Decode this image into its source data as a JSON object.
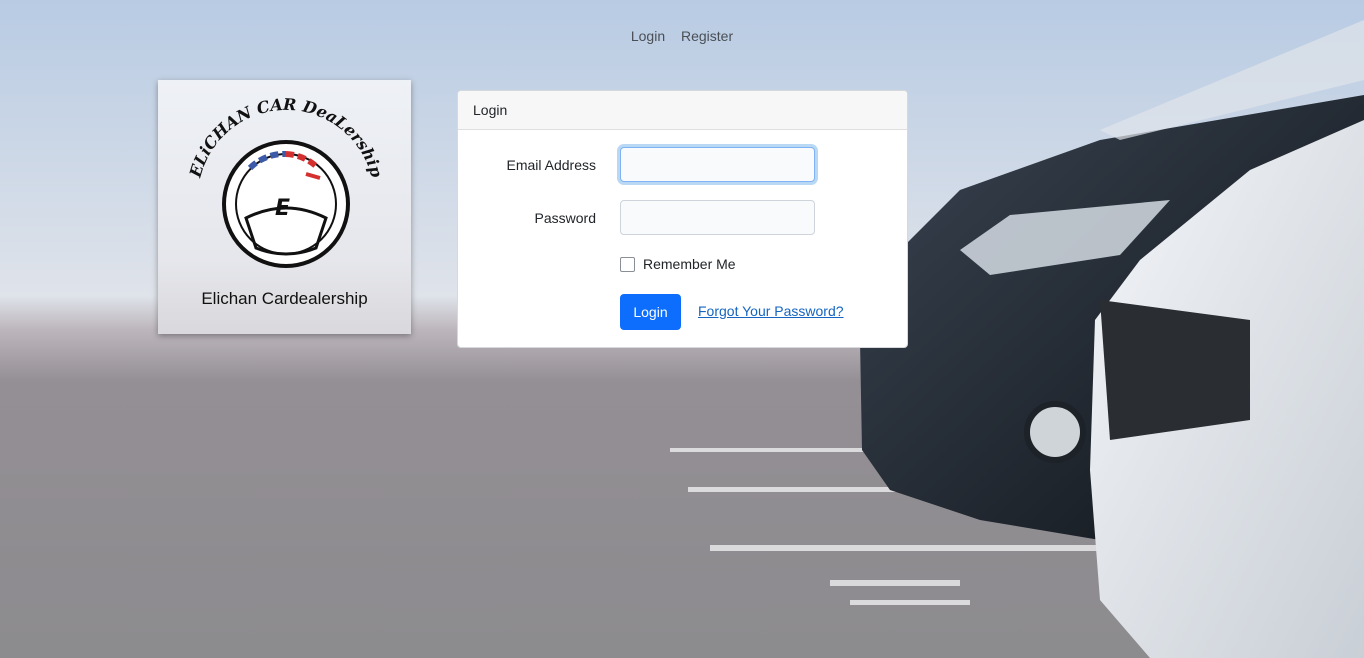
{
  "nav": {
    "login": "Login",
    "register": "Register"
  },
  "logo": {
    "brand_text": "ELiCHAN CAR DeaLership",
    "caption": "Elichan Cardealership"
  },
  "form": {
    "header": "Login",
    "email_label": "Email Address",
    "email_value": "",
    "password_label": "Password",
    "password_value": "",
    "remember_label": "Remember Me",
    "submit_label": "Login",
    "forgot_link": "Forgot Your Password?"
  },
  "colors": {
    "primary": "#0d6efd",
    "link": "#1565c0"
  }
}
